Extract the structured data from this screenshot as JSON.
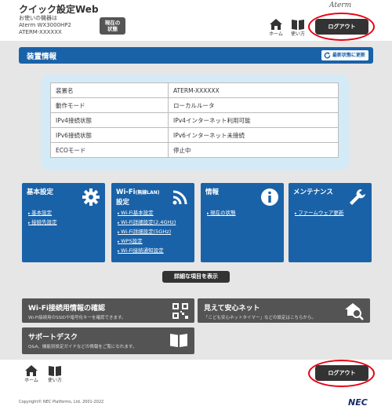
{
  "header": {
    "title": "クイック設定Web",
    "device_label": "お使いの機器は",
    "model": "Aterm WX3000HP2",
    "device_id": "ATERM-XXXXXX",
    "state_button_line1": "現在の",
    "state_button_line2": "状態",
    "brand": "Aterm",
    "home_label": "ホーム",
    "help_label": "使い方",
    "logout_label": "ログアウト"
  },
  "section": {
    "title": "装置情報",
    "refresh_label": "最新状態に更新"
  },
  "device_info": [
    {
      "key": "装置名",
      "value": "ATERM-XXXXXX"
    },
    {
      "key": "動作モード",
      "value": "ローカルルータ"
    },
    {
      "key": "IPv4接続状態",
      "value": "IPv4インターネット利用可能"
    },
    {
      "key": "IPv6接続状態",
      "value": "IPv6インターネット未接続"
    },
    {
      "key": "ECOモード",
      "value": "停止中"
    }
  ],
  "tiles": [
    {
      "title": "基本設定",
      "title_sub": "",
      "title2": "",
      "icon": "gear-icon",
      "links": [
        "基本設定",
        "接続先設定"
      ]
    },
    {
      "title": "Wi-Fi",
      "title_sub": "(無線LAN)",
      "title2": "設定",
      "icon": "wifi-icon",
      "links": [
        "Wi-Fi基本設定",
        "Wi-Fi詳細設定(2.4GHz)",
        "Wi-Fi詳細設定(5GHz)",
        "WPS設定",
        "Wi-Fi接続通知設定"
      ]
    },
    {
      "title": "情報",
      "title_sub": "",
      "title2": "",
      "icon": "info-icon",
      "links": [
        "現在の状態"
      ]
    },
    {
      "title": "メンテナンス",
      "title_sub": "",
      "title2": "",
      "icon": "wrench-icon",
      "links": [
        "ファームウェア更新"
      ]
    }
  ],
  "detail_button": "詳細な項目を表示",
  "wide_buttons": {
    "wifi_info_title": "Wi-Fi接続用情報の確認",
    "wifi_info_desc": "Wi-Fi接続用のSSIDや暗号化キーを確認できます。",
    "safe_net_title": "見えて安心ネット",
    "safe_net_desc": "「こども安心ネットタイマー」などの設定はこちらから。",
    "support_title": "サポートデスク",
    "support_desc": "Q&A、機能別設定ガイドなどの情報をご覧になれます。"
  },
  "footer": {
    "home_label": "ホーム",
    "help_label": "使い方",
    "logout_label": "ログアウト",
    "copyright": "Copyright© NEC Platforms, Ltd. 2001-2022",
    "logo": "NEC"
  },
  "colors": {
    "primary_blue": "#1a62a8",
    "highlight_red": "#e60012",
    "panel_blue": "#d4ebf7"
  }
}
